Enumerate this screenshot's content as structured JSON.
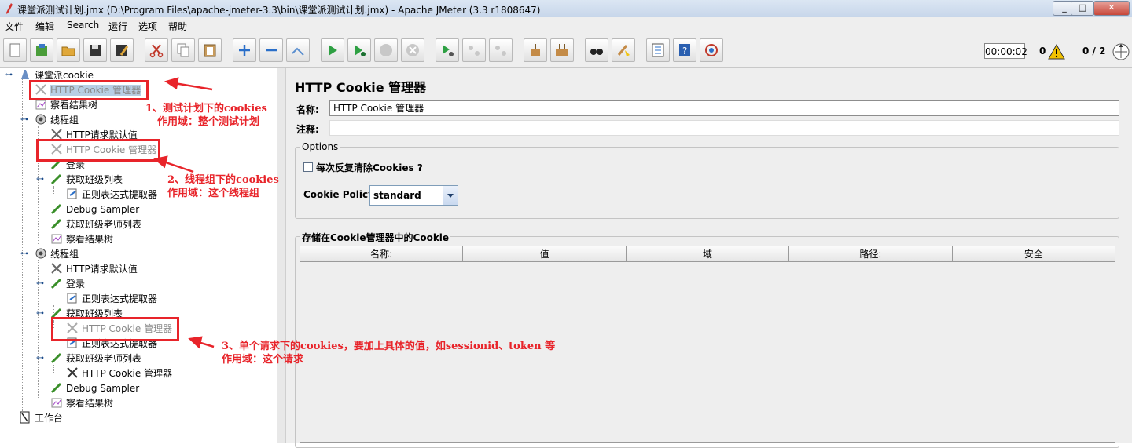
{
  "window": {
    "title": "课堂派测试计划.jmx (D:\\Program Files\\apache-jmeter-3.3\\bin\\课堂派测试计划.jmx) - Apache JMeter (3.3 r1808647)",
    "minimize": "_",
    "maximize": "□",
    "close": "✕"
  },
  "menu": [
    "文件",
    "编辑",
    "Search",
    "运行",
    "选项",
    "帮助"
  ],
  "toolbar": {
    "elapsed": "00:00:02",
    "warnings": "0",
    "threads": "0 / 2",
    "buttons": [
      "new-icon",
      "templates-icon",
      "open-icon",
      "save-icon",
      "save-as-icon",
      "cut-icon",
      "copy-icon",
      "paste-icon",
      "expand-icon",
      "collapse-icon",
      "toggle-icon",
      "start-icon",
      "start-no-pause-icon",
      "stop-icon",
      "shutdown-icon",
      "remote-start-icon",
      "remote-stop-icon",
      "remote-exit-icon",
      "clear-icon",
      "clear-all-icon",
      "search-icon",
      "reset-search-icon",
      "function-helper-icon",
      "help-icon",
      "log-icon"
    ]
  },
  "tree": [
    {
      "label": "课堂派cookie",
      "icon": "test-plan-icon",
      "depth": 0
    },
    {
      "label": "HTTP Cookie 管理器",
      "icon": "cookie-manager-icon",
      "depth": 1,
      "disabled": true,
      "selected": true
    },
    {
      "label": "察看结果树",
      "icon": "results-tree-icon",
      "depth": 1
    },
    {
      "label": "线程组",
      "icon": "thread-group-icon",
      "depth": 1
    },
    {
      "label": "HTTP请求默认值",
      "icon": "http-defaults-icon",
      "depth": 2
    },
    {
      "label": "HTTP Cookie 管理器",
      "icon": "cookie-manager-icon",
      "depth": 2,
      "disabled": true
    },
    {
      "label": "登录",
      "icon": "sampler-icon",
      "depth": 2
    },
    {
      "label": "获取班级列表",
      "icon": "sampler-icon",
      "depth": 2
    },
    {
      "label": "正则表达式提取器",
      "icon": "extractor-icon",
      "depth": 3
    },
    {
      "label": "Debug Sampler",
      "icon": "sampler-icon",
      "depth": 2
    },
    {
      "label": "获取班级老师列表",
      "icon": "sampler-icon",
      "depth": 2
    },
    {
      "label": "察看结果树",
      "icon": "results-tree-icon",
      "depth": 2
    },
    {
      "label": "线程组",
      "icon": "thread-group-icon",
      "depth": 1
    },
    {
      "label": "HTTP请求默认值",
      "icon": "http-defaults-icon",
      "depth": 2
    },
    {
      "label": "登录",
      "icon": "sampler-icon",
      "depth": 2
    },
    {
      "label": "正则表达式提取器",
      "icon": "extractor-icon",
      "depth": 3
    },
    {
      "label": "获取班级列表",
      "icon": "sampler-icon",
      "depth": 2
    },
    {
      "label": "HTTP Cookie 管理器",
      "icon": "cookie-manager-icon",
      "depth": 3,
      "disabled": true
    },
    {
      "label": "正则表达式提取器",
      "icon": "extractor-icon",
      "depth": 3
    },
    {
      "label": "获取班级老师列表",
      "icon": "sampler-icon",
      "depth": 2
    },
    {
      "label": "HTTP Cookie 管理器",
      "icon": "cookie-manager-icon",
      "depth": 3
    },
    {
      "label": "Debug Sampler",
      "icon": "sampler-icon",
      "depth": 2
    },
    {
      "label": "察看结果树",
      "icon": "results-tree-icon",
      "depth": 2
    },
    {
      "label": "工作台",
      "icon": "workbench-icon",
      "depth": 0
    }
  ],
  "panel": {
    "title": "HTTP Cookie 管理器",
    "name_label": "名称:",
    "name_value": "HTTP Cookie 管理器",
    "comment_label": "注释:",
    "comment_value": "",
    "options_legend": "Options",
    "clear_each_iteration": "每次反复清除Cookies ?",
    "clear_each_iteration_checked": false,
    "policy_label": "Cookie Policy:",
    "policy_value": "standard",
    "stored_legend": "存储在Cookie管理器中的Cookie",
    "columns": [
      "名称:",
      "值",
      "域",
      "路径:",
      "安全"
    ]
  },
  "annotations": [
    {
      "lines": [
        "1、测试计划下的cookies",
        "作用域：整个测试计划"
      ]
    },
    {
      "lines": [
        "2、线程组下的cookies",
        "作用域：这个线程组"
      ]
    },
    {
      "lines": [
        "3、单个请求下的cookies，要加上具体的值，如sessionid、token 等",
        "作用域：这个请求"
      ]
    }
  ],
  "colors": {
    "annotation": "#e8242a",
    "selection": "#b8cfe5",
    "panel_bg": "#eeeeee"
  }
}
